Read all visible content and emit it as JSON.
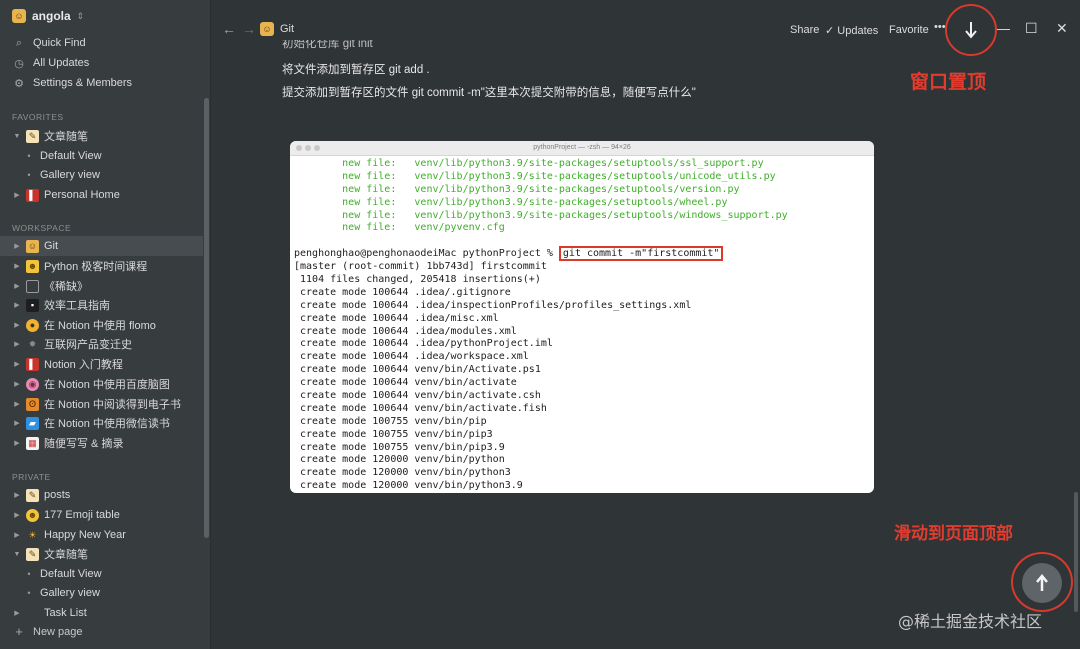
{
  "sidebar": {
    "workspace_name": "angola",
    "top_items": [
      {
        "label": "Quick Find",
        "icon": "search-icon"
      },
      {
        "label": "All Updates",
        "icon": "clock-icon"
      },
      {
        "label": "Settings & Members",
        "icon": "gear-icon"
      }
    ],
    "favorites_header": "FAVORITES",
    "favorites": [
      {
        "label": "文章随笔",
        "icon": "note-icon"
      },
      {
        "label": "Default View"
      },
      {
        "label": "Gallery view"
      },
      {
        "label": "Personal Home",
        "icon": "book-icon"
      }
    ],
    "workspace_header": "WORKSPACE",
    "workspace": [
      {
        "label": "Git",
        "icon": "person-icon"
      },
      {
        "label": "Python 极客时间课程",
        "icon": "smile-icon"
      },
      {
        "label": "《稀缺》",
        "icon": "page-icon"
      },
      {
        "label": "效率工具指南",
        "icon": "terminal-icon"
      },
      {
        "label": "在 Notion 中使用 flomo",
        "icon": "flomo-icon"
      },
      {
        "label": "互联网产品变迁史",
        "icon": "gear-icon"
      },
      {
        "label": "Notion 入门教程",
        "icon": "redbook-icon"
      },
      {
        "label": "在 Notion 中使用百度脑图",
        "icon": "brain-icon"
      },
      {
        "label": "在 Notion 中阅读得到电子书",
        "icon": "owl-icon"
      },
      {
        "label": "在 Notion 中使用微信读书",
        "icon": "wechat-icon"
      },
      {
        "label": "随便写写 & 摘录",
        "icon": "calendar-icon"
      }
    ],
    "private_header": "PRIVATE",
    "private": [
      {
        "label": "posts",
        "icon": "note-icon"
      },
      {
        "label": "177 Emoji table",
        "icon": "smile-icon"
      },
      {
        "label": "Happy New Year",
        "icon": "sun-icon"
      },
      {
        "label": "文章随笔",
        "icon": "note-icon"
      },
      {
        "label": "Default View"
      },
      {
        "label": "Gallery view"
      },
      {
        "label": "Task List"
      }
    ],
    "new_page": "New page"
  },
  "topbar": {
    "page_title": "Git",
    "share": "Share",
    "updates": "Updates",
    "favorite": "Favorite",
    "more": "•••"
  },
  "content": {
    "line0": "初始化仓库   git init",
    "line1": "将文件添加到暂存区   git add .",
    "line2": "提交添加到暂存区的文件   git commit -m\"这里本次提交附带的信息，随便写点什么\""
  },
  "terminal": {
    "title": "pythonProject — -zsh — 94×26",
    "green_lines": [
      "        new file:   venv/lib/python3.9/site-packages/setuptools/ssl_support.py",
      "        new file:   venv/lib/python3.9/site-packages/setuptools/unicode_utils.py",
      "        new file:   venv/lib/python3.9/site-packages/setuptools/version.py",
      "        new file:   venv/lib/python3.9/site-packages/setuptools/wheel.py",
      "        new file:   venv/lib/python3.9/site-packages/setuptools/windows_support.py",
      "        new file:   venv/pyvenv.cfg"
    ],
    "prompt": "penghonghao@penghonaodeiMac pythonProject % ",
    "command": "git commit -m\"firstcommit\"",
    "output_lines": [
      "[master (root-commit) 1bb743d] firstcommit",
      " 1104 files changed, 205418 insertions(+)",
      " create mode 100644 .idea/.gitignore",
      " create mode 100644 .idea/inspectionProfiles/profiles_settings.xml",
      " create mode 100644 .idea/misc.xml",
      " create mode 100644 .idea/modules.xml",
      " create mode 100644 .idea/pythonProject.iml",
      " create mode 100644 .idea/workspace.xml",
      " create mode 100644 venv/bin/Activate.ps1",
      " create mode 100644 venv/bin/activate",
      " create mode 100644 venv/bin/activate.csh",
      " create mode 100644 venv/bin/activate.fish",
      " create mode 100755 venv/bin/pip",
      " create mode 100755 venv/bin/pip3",
      " create mode 100755 venv/bin/pip3.9",
      " create mode 120000 venv/bin/python",
      " create mode 120000 venv/bin/python3",
      " create mode 120000 venv/bin/python3.9"
    ]
  },
  "annotations": {
    "pin_window": "窗口置顶",
    "scroll_top": "滑动到页面顶部",
    "accent_color": "#e23c2e"
  },
  "watermark": "@稀土掘金技术社区"
}
